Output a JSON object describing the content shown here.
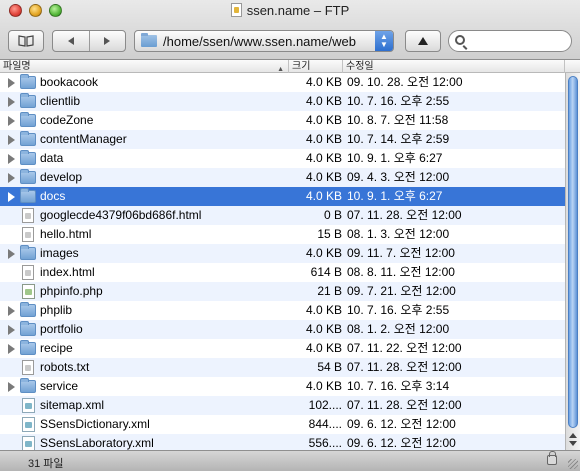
{
  "window": {
    "title": "ssen.name – FTP"
  },
  "toolbar": {
    "bookmarks_icon": "book-icon",
    "back_icon": "back-arrow-icon",
    "forward_icon": "forward-arrow-icon",
    "path": "/home/ssen/www.ssen.name/web",
    "up_icon": "up-arrow-icon",
    "search_placeholder": ""
  },
  "columns": {
    "name": "파일명",
    "size": "크기",
    "date": "수정일"
  },
  "files": [
    {
      "type": "folder",
      "name": "bookacook",
      "size": "4.0 KB",
      "date": "09. 10. 28. 오전 12:00"
    },
    {
      "type": "folder",
      "name": "clientlib",
      "size": "4.0 KB",
      "date": "10. 7. 16. 오후 2:55"
    },
    {
      "type": "folder",
      "name": "codeZone",
      "size": "4.0 KB",
      "date": "10. 8. 7. 오전 11:58"
    },
    {
      "type": "folder",
      "name": "contentManager",
      "size": "4.0 KB",
      "date": "10. 7. 14. 오후 2:59"
    },
    {
      "type": "folder",
      "name": "data",
      "size": "4.0 KB",
      "date": "10. 9. 1. 오후 6:27"
    },
    {
      "type": "folder",
      "name": "develop",
      "size": "4.0 KB",
      "date": "09. 4. 3. 오전 12:00"
    },
    {
      "type": "folder",
      "name": "docs",
      "size": "4.0 KB",
      "date": "10. 9. 1. 오후 6:27",
      "selected": true
    },
    {
      "type": "file",
      "name": "googlecde4379f06bd686f.html",
      "size": "0 B",
      "date": "07. 11. 28. 오전 12:00"
    },
    {
      "type": "file",
      "name": "hello.html",
      "size": "15 B",
      "date": "08. 1. 3. 오전 12:00"
    },
    {
      "type": "folder",
      "name": "images",
      "size": "4.0 KB",
      "date": "09. 11. 7. 오전 12:00"
    },
    {
      "type": "file",
      "name": "index.html",
      "size": "614 B",
      "date": "08. 8. 11. 오전 12:00"
    },
    {
      "type": "php",
      "name": "phpinfo.php",
      "size": "21 B",
      "date": "09. 7. 21. 오전 12:00"
    },
    {
      "type": "folder",
      "name": "phplib",
      "size": "4.0 KB",
      "date": "10. 7. 16. 오후 2:55"
    },
    {
      "type": "folder",
      "name": "portfolio",
      "size": "4.0 KB",
      "date": "08. 1. 2. 오전 12:00"
    },
    {
      "type": "folder",
      "name": "recipe",
      "size": "4.0 KB",
      "date": "07. 11. 22. 오전 12:00"
    },
    {
      "type": "file",
      "name": "robots.txt",
      "size": "54 B",
      "date": "07. 11. 28. 오전 12:00"
    },
    {
      "type": "folder",
      "name": "service",
      "size": "4.0 KB",
      "date": "10. 7. 16. 오후 3:14"
    },
    {
      "type": "xml",
      "name": "sitemap.xml",
      "size": "102....",
      "date": "07. 11. 28. 오전 12:00"
    },
    {
      "type": "xml",
      "name": "SSensDictionary.xml",
      "size": "844....",
      "date": "09. 6. 12. 오전 12:00"
    },
    {
      "type": "xml",
      "name": "SSensLaboratory.xml",
      "size": "556....",
      "date": "09. 6. 12. 오전 12:00"
    }
  ],
  "status": {
    "count": "31 파일"
  },
  "colors": {
    "selection": "#3875d7",
    "stripe": "#edf3fe"
  }
}
